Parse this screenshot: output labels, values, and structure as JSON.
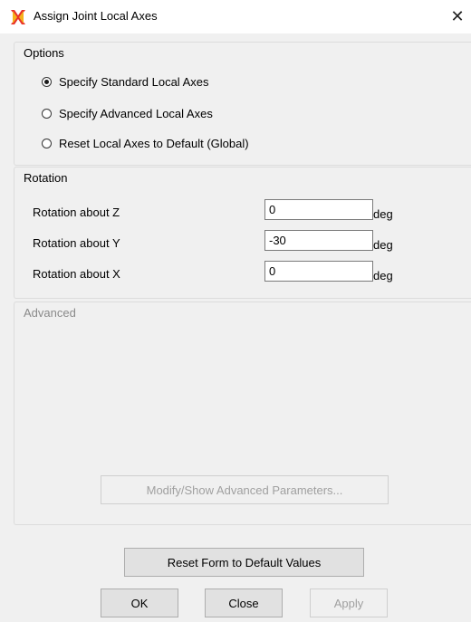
{
  "window": {
    "title": "Assign Joint Local Axes",
    "close_symbol": "✕",
    "icon": "app-logo-icon"
  },
  "options": {
    "label": "Options",
    "items": [
      {
        "label": "Specify Standard Local Axes",
        "checked": true
      },
      {
        "label": "Specify Advanced Local Axes",
        "checked": false
      },
      {
        "label": "Reset Local Axes to Default  (Global)",
        "checked": false
      }
    ]
  },
  "rotation": {
    "label": "Rotation",
    "fields": [
      {
        "label": "Rotation about Z",
        "value": "0",
        "unit": "deg"
      },
      {
        "label": "Rotation about Y",
        "value": "-30",
        "unit": "deg"
      },
      {
        "label": "Rotation about X",
        "value": "0",
        "unit": "deg"
      }
    ]
  },
  "advanced": {
    "label": "Advanced",
    "button_label": "Modify/Show Advanced Parameters..."
  },
  "buttons": {
    "reset": "Reset Form to Default Values",
    "ok": "OK",
    "close": "Close",
    "apply": "Apply"
  }
}
